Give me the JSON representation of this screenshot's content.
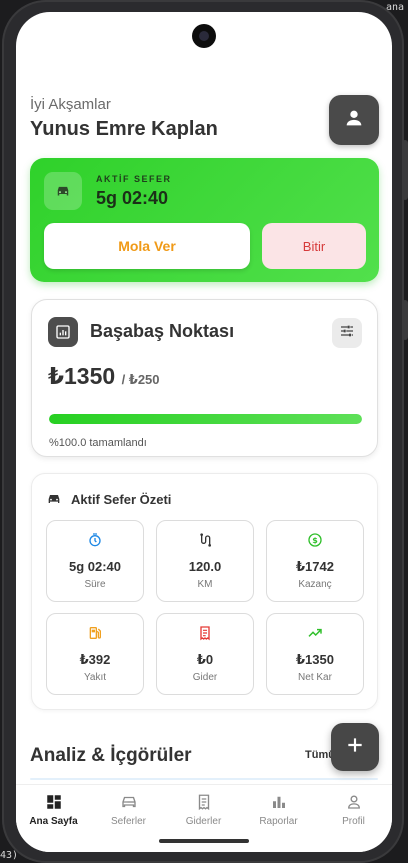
{
  "header": {
    "greeting": "İyi Akşamlar",
    "user_name": "Yunus Emre Kaplan",
    "profile_icon": "person-icon"
  },
  "active_trip": {
    "label": "AKTİF SEFER",
    "duration": "5g 02:40",
    "pause_label": "Mola Ver",
    "finish_label": "Bitir",
    "accent": "#2fd12a"
  },
  "break_even": {
    "title": "Başabaş Noktası",
    "amount": "₺1350",
    "target": "/ ₺250",
    "progress_percent": 100,
    "progress_text": "%100.0 tamamlandı"
  },
  "summary": {
    "title": "Aktif Sefer Özeti",
    "tiles": [
      {
        "value": "5g 02:40",
        "label": "Süre",
        "icon": "timer-icon",
        "color": "#1e88e5"
      },
      {
        "value": "120.0",
        "label": "KM",
        "icon": "route-icon",
        "color": "#333333"
      },
      {
        "value": "₺1742",
        "label": "Kazanç",
        "icon": "dollar-icon",
        "color": "#2fbf2a"
      },
      {
        "value": "₺392",
        "label": "Yakıt",
        "icon": "fuel-icon",
        "color": "#f0a020"
      },
      {
        "value": "₺0",
        "label": "Gider",
        "icon": "receipt-icon",
        "color": "#e53935"
      },
      {
        "value": "₺1350",
        "label": "Net Kar",
        "icon": "trending-up-icon",
        "color": "#2fbf2a"
      }
    ]
  },
  "analysis": {
    "title": "Analiz & İçgörüler",
    "see_all": "Tümü"
  },
  "nav": {
    "items": [
      {
        "label": "Ana Sayfa",
        "icon": "dashboard-icon",
        "active": true
      },
      {
        "label": "Seferler",
        "icon": "car-icon",
        "active": false
      },
      {
        "label": "Giderler",
        "icon": "receipt-icon",
        "active": false
      },
      {
        "label": "Raporlar",
        "icon": "bar-chart-icon",
        "active": false
      },
      {
        "label": "Profil",
        "icon": "person-icon",
        "active": false
      }
    ]
  },
  "backdrop": {
    "top_right": "ana",
    "bottom_left": "43)"
  }
}
